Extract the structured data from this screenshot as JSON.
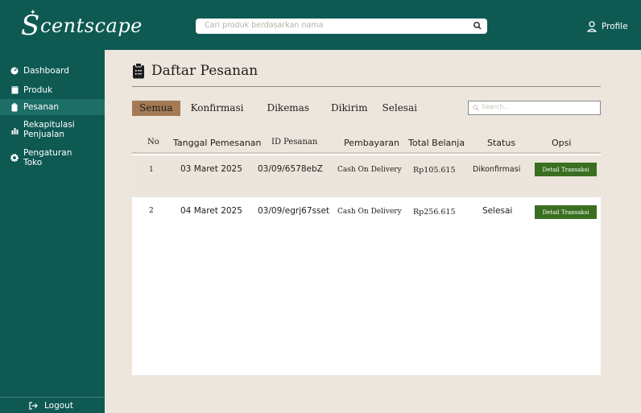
{
  "app": {
    "logo_initial": "S",
    "logo_rest": "centscape"
  },
  "header": {
    "search_placeholder": "Cari produk berdasarkan nama",
    "profile_label": "Profile"
  },
  "sidebar": {
    "items": [
      {
        "label": "Dashboard",
        "icon": "dashboard-icon"
      },
      {
        "label": "Produk",
        "icon": "product-icon"
      },
      {
        "label": "Pesanan",
        "icon": "clipboard-icon"
      },
      {
        "label": "Rekapitulasi Penjualan",
        "icon": "bar-chart-icon"
      },
      {
        "label": "Pengaturan Toko",
        "icon": "gear-icon"
      }
    ],
    "active": "Pesanan",
    "logout_label": "Logout"
  },
  "main": {
    "title": "Daftar Pesanan",
    "tabs": [
      "Semua",
      "Konfirmasi",
      "Dikemas",
      "Dikirim",
      "Selesai"
    ],
    "active_tab": "Semua",
    "search_placeholder": "Search...",
    "table": {
      "columns": [
        "No",
        "Tanggal Pemesanan",
        "ID Pesanan",
        "Pembayaran",
        "Total Belanja",
        "Status",
        "Opsi"
      ],
      "rows": [
        {
          "no": "1",
          "date": "03 Maret 2025",
          "id": "03/09/6578ebZ",
          "payment": "Cash On Delivery",
          "total": "Rp105.615",
          "status": "Dikonfirmasi",
          "action": "Detail Transaksi"
        },
        {
          "no": "2",
          "date": "04 Maret 2025",
          "id": "03/09/egrj67sset",
          "payment": "Cash On Delivery",
          "total": "Rp256.615",
          "status": "Selesai",
          "action": "Detail Transaksi"
        }
      ]
    }
  },
  "colors": {
    "primary": "#0e5a53",
    "background": "#ede6dc",
    "active_tab": "#a47a55",
    "action_button": "#3a6e21"
  }
}
